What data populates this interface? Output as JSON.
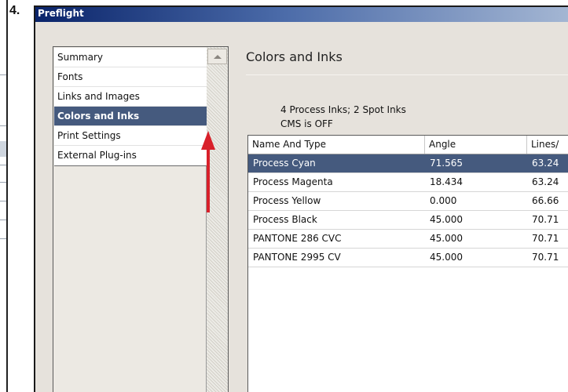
{
  "step_label": "4.",
  "window": {
    "title": "Preflight"
  },
  "categories": [
    {
      "label": "Summary",
      "selected": false
    },
    {
      "label": "Fonts",
      "selected": false
    },
    {
      "label": "Links and Images",
      "selected": false
    },
    {
      "label": "Colors and Inks",
      "selected": true
    },
    {
      "label": "Print Settings",
      "selected": false
    },
    {
      "label": "External Plug-ins",
      "selected": false
    }
  ],
  "panel": {
    "title": "Colors and Inks",
    "summary_line_1": "4 Process Inks; 2 Spot Inks",
    "summary_line_2": "CMS is OFF"
  },
  "table": {
    "columns": [
      "Name And Type",
      "Angle",
      "Lines/"
    ],
    "rows": [
      {
        "name": "Process Cyan",
        "angle": "71.565",
        "lines": "63.24",
        "selected": true
      },
      {
        "name": "Process Magenta",
        "angle": "18.434",
        "lines": "63.24",
        "selected": false
      },
      {
        "name": "Process Yellow",
        "angle": "0.000",
        "lines": "66.66",
        "selected": false
      },
      {
        "name": "Process Black",
        "angle": "45.000",
        "lines": "70.71",
        "selected": false
      },
      {
        "name": "PANTONE 286 CVC",
        "angle": "45.000",
        "lines": "70.71",
        "selected": false
      },
      {
        "name": "PANTONE 2995 CV",
        "angle": "45.000",
        "lines": "70.71",
        "selected": false
      }
    ]
  },
  "colors": {
    "selection": "#455a7e",
    "title_bar_start": "#0a246a",
    "title_bar_end": "#a6b8d4",
    "annotation_arrow": "#d8202a",
    "panel_background": "#e6e2dc"
  },
  "icons": {
    "scroll_up": "triangle-up",
    "scroll_down": "triangle-down",
    "annotation": "red-arrow-up"
  }
}
